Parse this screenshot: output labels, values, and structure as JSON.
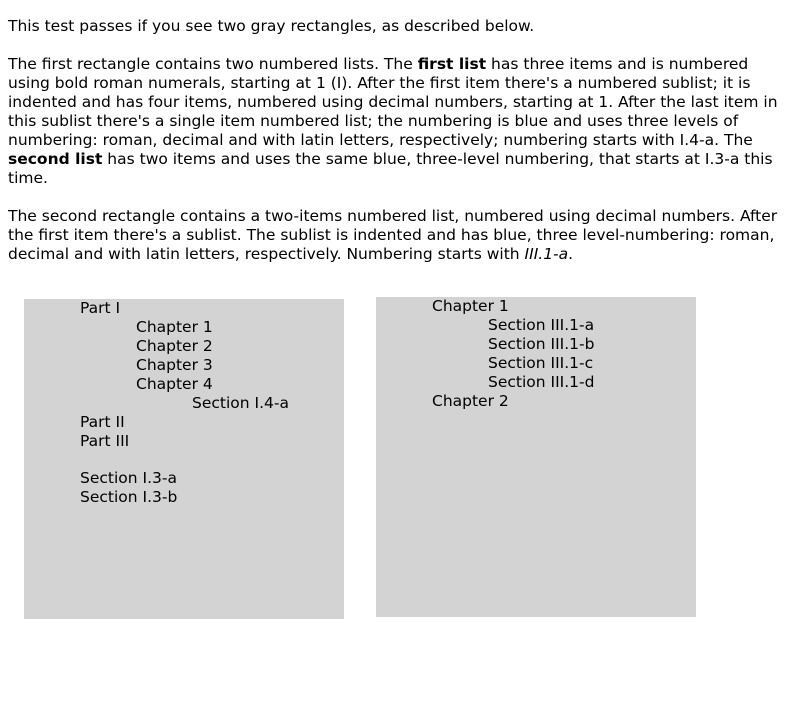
{
  "intro": "This test passes if you see two gray rectangles, as described below.",
  "para1": {
    "t1": "The first rectangle contains two numbered lists. The ",
    "b1": "first list",
    "t2": " has three items and is numbered using bold roman numerals, starting at 1 (I). After the first item there's a numbered sublist; it is indented and has four items, numbered using decimal numbers, starting at 1. After the last item in this sublist there's a single item numbered list; the numbering is blue and uses three levels of numbering: roman, decimal and with latin letters, respectively; numbering starts with I.4-a. The ",
    "b2": "second list",
    "t3": " has two items and uses the same blue, three-level numbering, that starts at I.3-a this time."
  },
  "para2": {
    "t1": "The second rectangle contains a two-items numbered list, numbered using decimal numbers. After the first item there's a sublist. The sublist is indented and has blue, three level-numbering: roman, decimal and with latin letters, respectively. Numbering starts with ",
    "i1": "III.1-a",
    "t2": "."
  },
  "box1": {
    "part1": "Part I",
    "chapter1": "Chapter 1",
    "chapter2": "Chapter 2",
    "chapter3": "Chapter 3",
    "chapter4": "Chapter 4",
    "section_i4a": "Section I.4-a",
    "part2": "Part II",
    "part3": "Part III",
    "section_i3a": "Section I.3-a",
    "section_i3b": "Section I.3-b"
  },
  "box2": {
    "chapter1": "Chapter 1",
    "section_a": "Section III.1-a",
    "section_b": "Section III.1-b",
    "section_c": "Section III.1-c",
    "section_d": "Section III.1-d",
    "chapter2": "Chapter 2"
  }
}
